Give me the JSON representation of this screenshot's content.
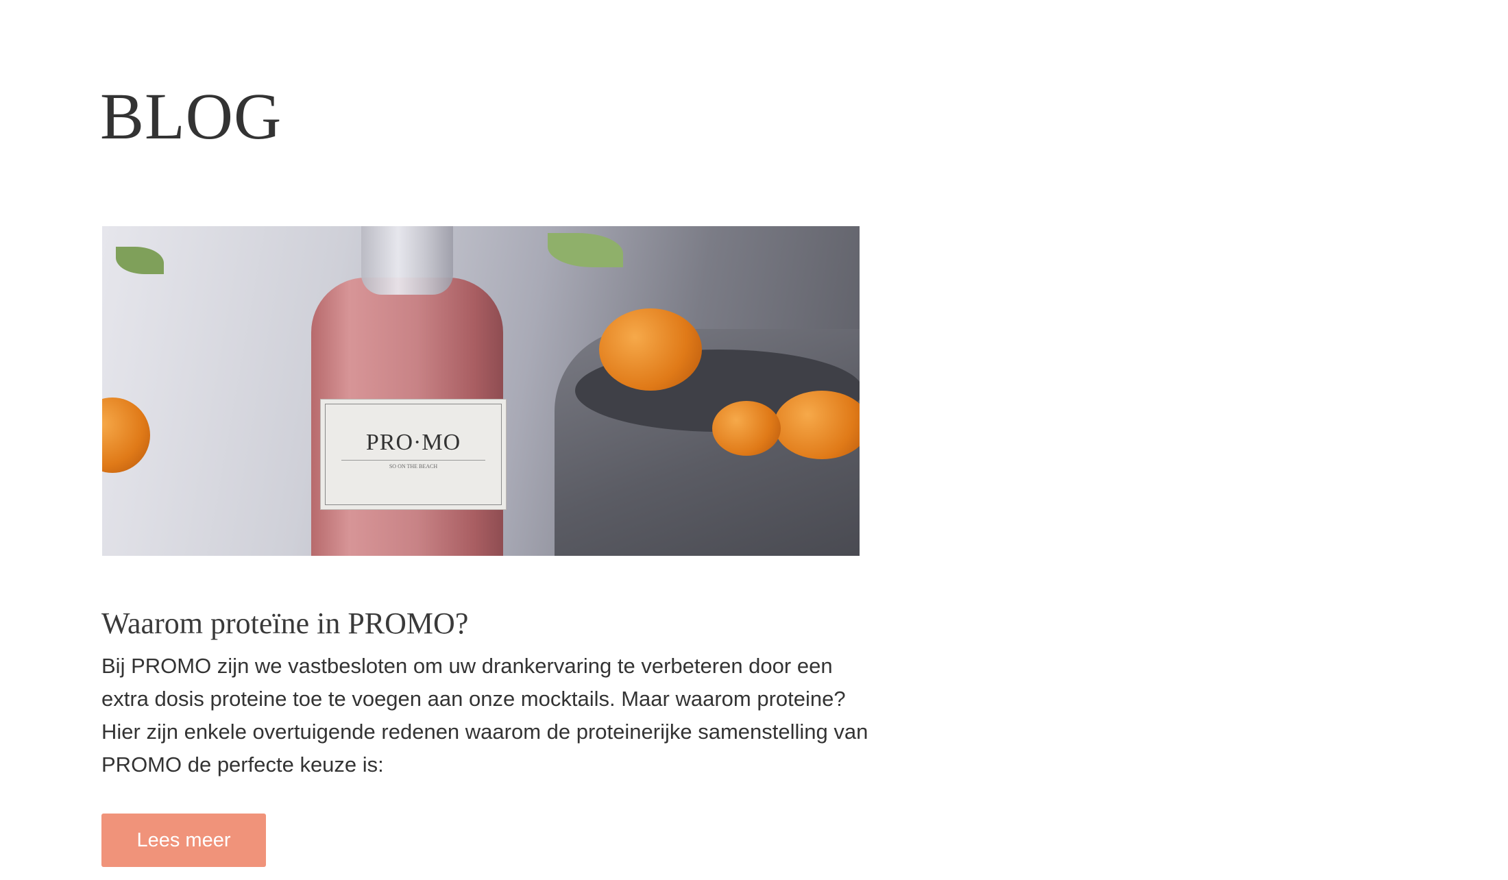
{
  "page": {
    "title": "BLOG"
  },
  "post": {
    "image_logo_text": "PRO·MO",
    "image_label_sub": "SO ON THE BEACH",
    "heading": "Waarom proteïne in PROMO?",
    "excerpt": "Bij PROMO zijn we vastbesloten om uw drankervaring te verbeteren door een extra dosis proteine toe te voegen aan onze mocktails. Maar waarom proteine? Hier zijn enkele overtuigende redenen waarom de proteinerijke samenstelling van PROMO de perfecte keuze is:",
    "read_more_label": "Lees meer"
  },
  "colors": {
    "accent": "#f0937a",
    "text": "#333333"
  }
}
